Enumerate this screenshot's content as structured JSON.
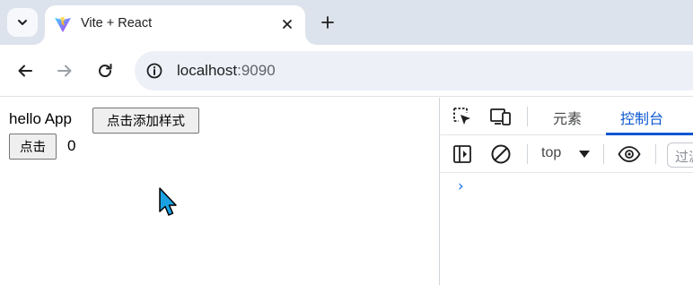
{
  "browser": {
    "tab": {
      "title": "Vite + React"
    },
    "address": {
      "host": "localhost",
      "port": ":9090"
    }
  },
  "page": {
    "hello_text": "hello App",
    "style_button_label": "点击添加样式",
    "click_button_label": "点击",
    "count": "0"
  },
  "devtools": {
    "tabs": [
      {
        "label": "元素",
        "active": false
      },
      {
        "label": "控制台",
        "active": true
      }
    ],
    "context": "top",
    "filter_placeholder": "过滤",
    "prompt_symbol": "›"
  },
  "colors": {
    "tabstrip_bg": "#dde3ec",
    "omnibox_bg": "#edf0f7",
    "accent": "#0b57d0",
    "cursor": "#1ba1e2"
  },
  "icons": {
    "tabstrip": [
      "tab-search-icon",
      "vite-logo-icon",
      "close-icon",
      "new-tab-plus-icon"
    ],
    "toolbar": [
      "back-arrow-icon",
      "forward-arrow-icon",
      "reload-icon",
      "site-info-icon"
    ],
    "devtools": [
      "inspect-element-icon",
      "device-toolbar-icon",
      "sidebar-toggle-icon",
      "clear-console-icon",
      "dropdown-triangle-icon",
      "live-expression-eye-icon"
    ]
  }
}
